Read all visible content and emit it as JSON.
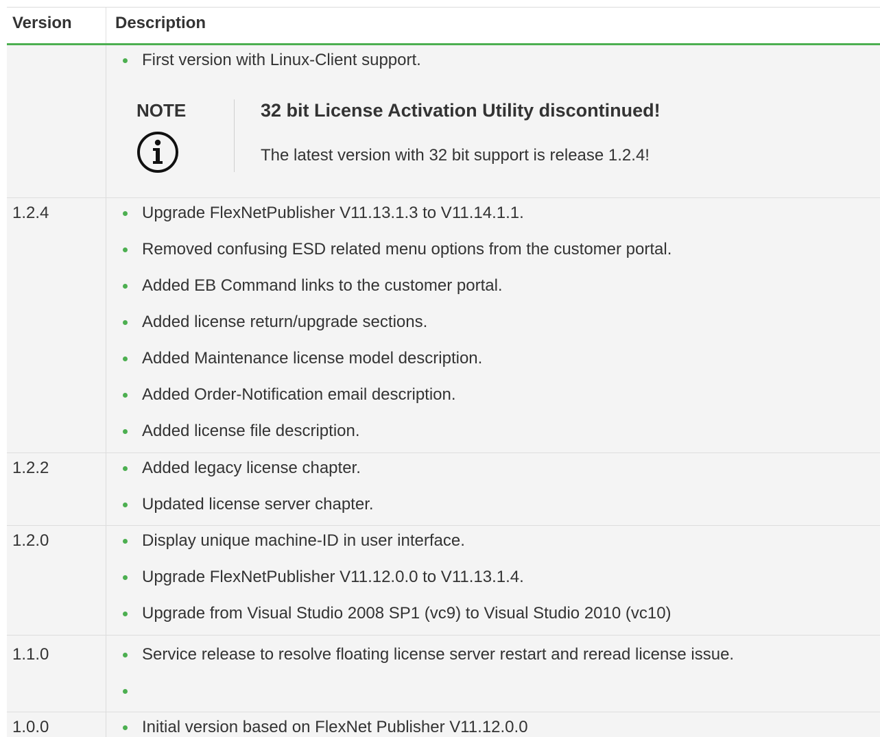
{
  "header": {
    "version": "Version",
    "description": "Description"
  },
  "note": {
    "label": "NOTE",
    "title": "32 bit License Activation Utility discontinued!",
    "text": "The latest version with 32 bit support is release 1.2.4!"
  },
  "rows": [
    {
      "version": "",
      "items": [
        "First version with Linux-Client support."
      ]
    },
    {
      "version": "1.2.4",
      "items": [
        "Upgrade FlexNetPublisher V11.13.1.3 to V11.14.1.1.",
        "Removed confusing ESD related menu options from the customer portal.",
        "Added EB Command links to the customer portal.",
        "Added license return/upgrade sections.",
        "Added Maintenance license model description.",
        "Added Order-Notification email description.",
        "Added license file description."
      ]
    },
    {
      "version": "1.2.2",
      "items": [
        "Added legacy license chapter.",
        "Updated license server chapter."
      ]
    },
    {
      "version": "1.2.0",
      "items": [
        "Display unique machine-ID in user interface.",
        "Upgrade FlexNetPublisher V11.12.0.0 to V11.13.1.4.",
        "Upgrade from Visual Studio 2008 SP1 (vc9) to Visual Studio 2010 (vc10)"
      ]
    },
    {
      "version": "1.1.0",
      "items": [
        "Service release to resolve floating license server restart and reread license issue.",
        ""
      ]
    },
    {
      "version": "1.0.0",
      "items": [
        "Initial version based on FlexNet Publisher V11.12.0.0"
      ]
    }
  ],
  "colors": {
    "accent": "#4caf50",
    "row_bg": "#f4f4f4"
  },
  "icons": {
    "note": "info-circle-icon"
  }
}
